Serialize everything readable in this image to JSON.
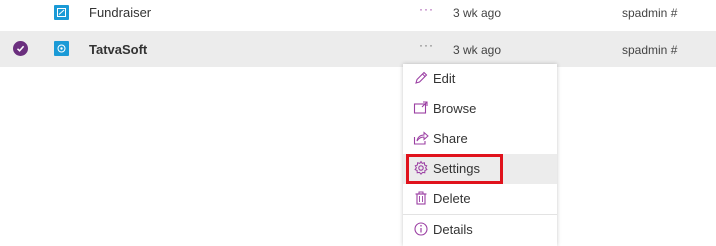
{
  "rows": [
    {
      "name": "Fundraiser",
      "more": "···",
      "modified": "3 wk ago",
      "author": "spadmin #",
      "icon": "site-icon",
      "selected": false
    },
    {
      "name": "TatvaSoft",
      "more": "···",
      "modified": "3 wk ago",
      "author": "spadmin #",
      "icon": "site-icon",
      "selected": true
    }
  ],
  "context_menu": {
    "items": [
      {
        "label": "Edit",
        "icon": "pencil-icon"
      },
      {
        "label": "Browse",
        "icon": "browse-icon"
      },
      {
        "label": "Share",
        "icon": "share-icon"
      },
      {
        "label": "Settings",
        "icon": "gear-icon",
        "highlighted": true
      },
      {
        "label": "Delete",
        "icon": "trash-icon"
      },
      {
        "label": "Details",
        "icon": "info-icon"
      }
    ]
  },
  "colors": {
    "accent": "#6b2f7e",
    "icon_purple": "#9b3fa3",
    "file_blue": "#1a9ad6",
    "highlight_red": "#e0121c",
    "selected_row": "#ececec"
  }
}
